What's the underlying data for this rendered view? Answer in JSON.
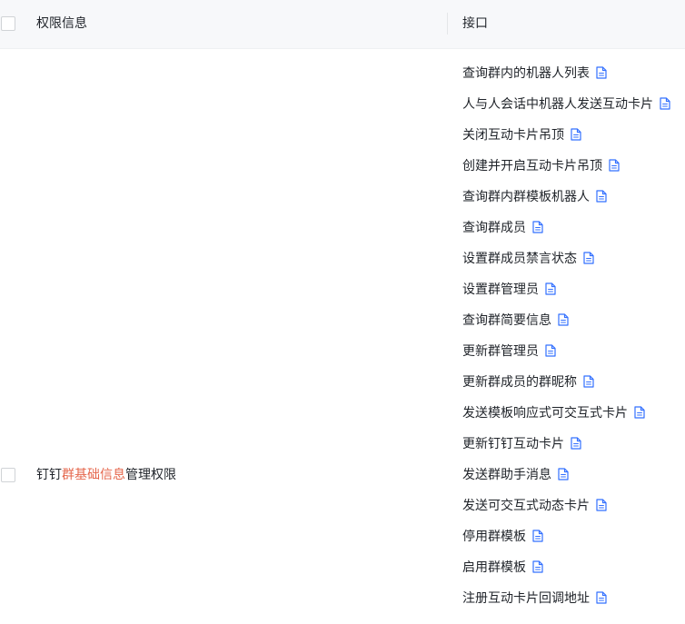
{
  "table": {
    "header": {
      "permission_label": "权限信息",
      "api_label": "接口"
    },
    "row": {
      "permission": {
        "prefix": "钉钉",
        "highlight": "群基础信息",
        "suffix": "管理权限",
        "highlight_color": "#e5664b"
      },
      "apis": [
        {
          "label": "查询群内的机器人列表",
          "icon": "doc-icon"
        },
        {
          "label": "人与人会话中机器人发送互动卡片",
          "icon": "doc-icon"
        },
        {
          "label": "关闭互动卡片吊顶",
          "icon": "doc-icon"
        },
        {
          "label": "创建并开启互动卡片吊顶",
          "icon": "doc-icon"
        },
        {
          "label": "查询群内群模板机器人",
          "icon": "doc-icon"
        },
        {
          "label": "查询群成员",
          "icon": "doc-icon"
        },
        {
          "label": "设置群成员禁言状态",
          "icon": "doc-icon"
        },
        {
          "label": "设置群管理员",
          "icon": "doc-icon"
        },
        {
          "label": "查询群简要信息",
          "icon": "doc-icon"
        },
        {
          "label": "更新群管理员",
          "icon": "doc-icon"
        },
        {
          "label": "更新群成员的群昵称",
          "icon": "doc-icon"
        },
        {
          "label": "发送模板响应式可交互式卡片",
          "icon": "doc-icon"
        },
        {
          "label": "更新钉钉互动卡片",
          "icon": "doc-icon"
        },
        {
          "label": "发送群助手消息",
          "icon": "doc-icon"
        },
        {
          "label": "发送可交互式动态卡片",
          "icon": "doc-icon"
        },
        {
          "label": "停用群模板",
          "icon": "doc-icon"
        },
        {
          "label": "启用群模板",
          "icon": "doc-icon"
        },
        {
          "label": "注册互动卡片回调地址",
          "icon": "doc-icon"
        }
      ]
    }
  },
  "colors": {
    "header_bg": "#f7f8fa",
    "text": "#1f2329",
    "icon": "#3370ff"
  }
}
